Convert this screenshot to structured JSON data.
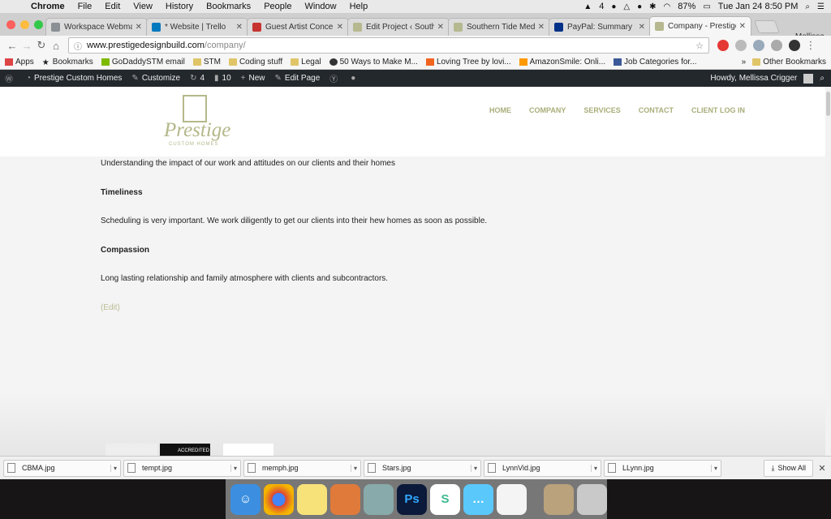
{
  "menubar": {
    "app": "Chrome",
    "menus": [
      "File",
      "Edit",
      "View",
      "History",
      "Bookmarks",
      "People",
      "Window",
      "Help"
    ],
    "status_badge": "4",
    "battery": "87%",
    "datetime": "Tue Jan 24  8:50 PM"
  },
  "tabs": [
    {
      "title": "Workspace Webmail",
      "color": "#8a8f95"
    },
    {
      "title": "* Website | Trello",
      "color": "#0079bf"
    },
    {
      "title": "Guest Artist Concerts",
      "color": "#c7342f"
    },
    {
      "title": "Edit Project ‹ Southern",
      "color": "#b6b98f"
    },
    {
      "title": "Southern Tide Media",
      "color": "#b6b98f"
    },
    {
      "title": "PayPal: Summary",
      "color": "#003087"
    },
    {
      "title": "Company - Prestige C",
      "color": "#b6b98f"
    }
  ],
  "profile": "Mellissa",
  "address": {
    "host": "www.prestigedesignbuild.com",
    "path": "/company/"
  },
  "bookmarks": [
    "Apps",
    "Bookmarks",
    "GoDaddySTM email",
    "STM",
    "Coding stuff",
    "Legal",
    "50 Ways to Make M...",
    "Loving Tree by lovi...",
    "AmazonSmile: Onli...",
    "Job Categories for..."
  ],
  "bookmarks_other": "Other Bookmarks",
  "wpbar": {
    "site": "Prestige Custom Homes",
    "customize": "Customize",
    "updates": "4",
    "comments": "10",
    "new": "New",
    "edit": "Edit Page",
    "howdy": "Howdy, Mellissa Crigger"
  },
  "site": {
    "logo_word": "Prestige",
    "logo_sub": "CUSTOM HOMES",
    "nav": [
      "HOME",
      "COMPANY",
      "SERVICES",
      "CONTACT",
      "CLIENT LOG IN"
    ]
  },
  "content": {
    "p1": "Understanding the impact of our work and attitudes on our clients and their homes",
    "h1": "Timeliness",
    "p2": "Scheduling is very important. We work diligently to get our clients into their hew homes as soon as possible.",
    "h2": "Compassion",
    "p3": "Long lasting relationship and family atmosphere with clients and subcontractors.",
    "edit": "(Edit)"
  },
  "downloads": [
    "CBMA.jpg",
    "tempt.jpg",
    "memph.jpg",
    "Stars.jpg",
    "LynnVid.jpg",
    "LLynn.jpg"
  ],
  "show_all": "Show All",
  "accredited": "ACCREDITED"
}
